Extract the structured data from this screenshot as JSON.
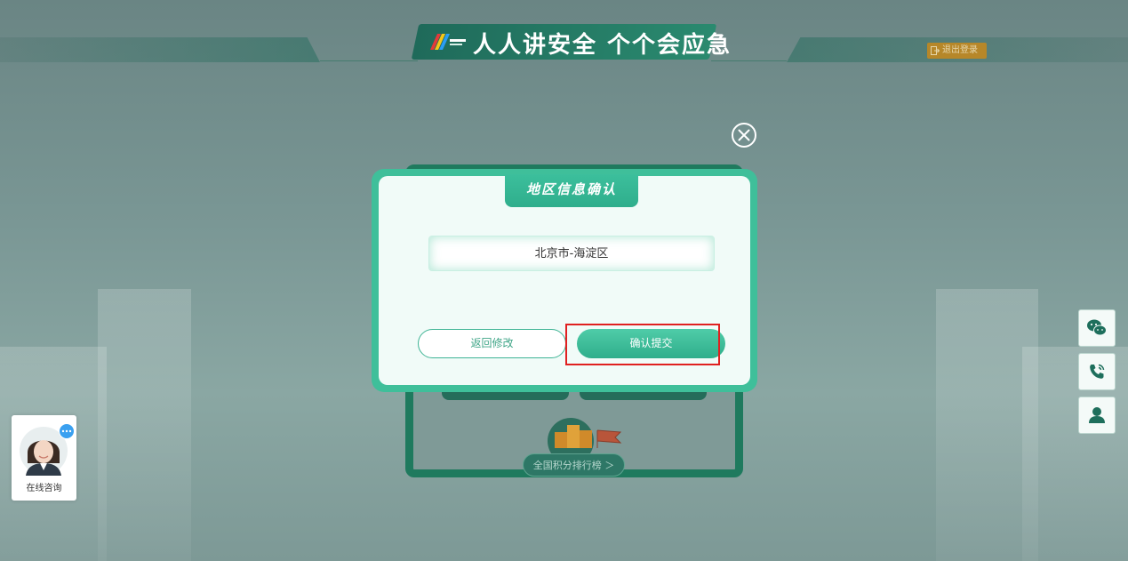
{
  "header": {
    "title": "人人讲安全 个个会应急",
    "logout_label": "退出登录"
  },
  "modal": {
    "tab_title": "地区信息确认",
    "region_value": "北京市-海淀区",
    "back_label": "返回修改",
    "confirm_label": "确认提交"
  },
  "background_card": {
    "ranking_link": "全国积分排行榜 ＞"
  },
  "consult": {
    "label": "在线咨询"
  },
  "side_toolbar": {
    "icons": [
      "wechat-icon",
      "phone-icon",
      "user-icon"
    ]
  },
  "colors": {
    "accent": "#3fbf9a",
    "highlight": "#e02020",
    "logout": "#c8891c"
  }
}
